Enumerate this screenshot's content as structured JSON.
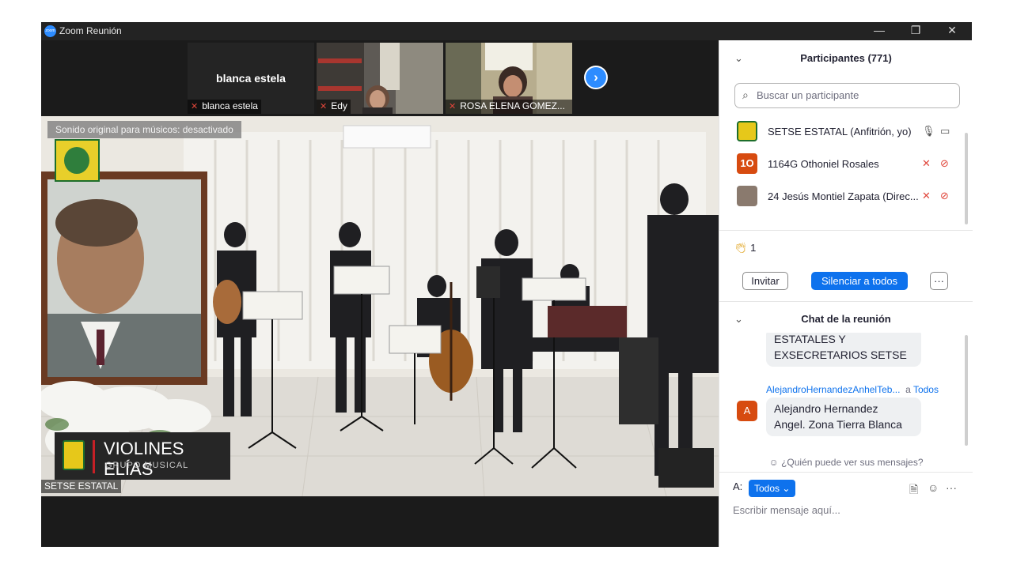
{
  "window": {
    "title": "Zoom Reunión",
    "app_logo_text": "zoom",
    "controls": {
      "minimize": "—",
      "restore": "❐",
      "close": "✕"
    }
  },
  "thumbnails": [
    {
      "display_name": "blanca estela",
      "caption": "blanca estela",
      "video": false
    },
    {
      "display_name": "",
      "caption": "Edy",
      "video": true
    },
    {
      "display_name": "",
      "caption": "ROSA ELENA GOMEZ...",
      "video": true
    }
  ],
  "next_button_icon": "chevron-right-icon",
  "main_video": {
    "sound_note": "Sonido original para músicos: desactivado",
    "banner_title": "VIOLINES ELÍAS",
    "banner_subtitle": "GRUPO MUSICAL",
    "speaker": "SETSE ESTATAL"
  },
  "participants": {
    "header": "Participantes (771)",
    "search_placeholder": "Buscar un participante",
    "items": [
      {
        "name": "SETSE ESTATAL (Anfitrión, yo)",
        "avatar": "",
        "avatar_color": "#e6c81a",
        "muted": false
      },
      {
        "name": "1164G Othoniel Rosales",
        "avatar": "1O",
        "avatar_color": "#d74b10",
        "muted": true
      },
      {
        "name": "24 Jesús Montiel Zapata (Direc...",
        "avatar": "",
        "avatar_color": "#8a7a6e",
        "muted": true
      }
    ],
    "reaction_icon": "clapping-hands-icon",
    "reaction_count": "1",
    "invite_label": "Invitar",
    "mute_all_label": "Silenciar a todos",
    "more_label": "···"
  },
  "chat": {
    "header": "Chat de la reunión",
    "partial_message": [
      "ESTATALES Y",
      "EXSECRETARIOS SETSE"
    ],
    "messages": [
      {
        "sender": "AlejandroHernandezAnhelTeb...",
        "to_prefix": "a",
        "to": "Todos",
        "avatar": "A",
        "lines": [
          "Alejandro Hernandez",
          "Angel.  Zona Tierra Blanca"
        ]
      }
    ],
    "who_can_see": "¿Quién puede ver sus mensajes?",
    "to_label": "A:",
    "recipient": "Todos",
    "compose_placeholder": "Escribir mensaje aquí...",
    "more_label": "···"
  },
  "colors": {
    "accent": "#0e72ed",
    "muted_red": "#e0463b",
    "zoom_blue": "#2d8cff"
  }
}
